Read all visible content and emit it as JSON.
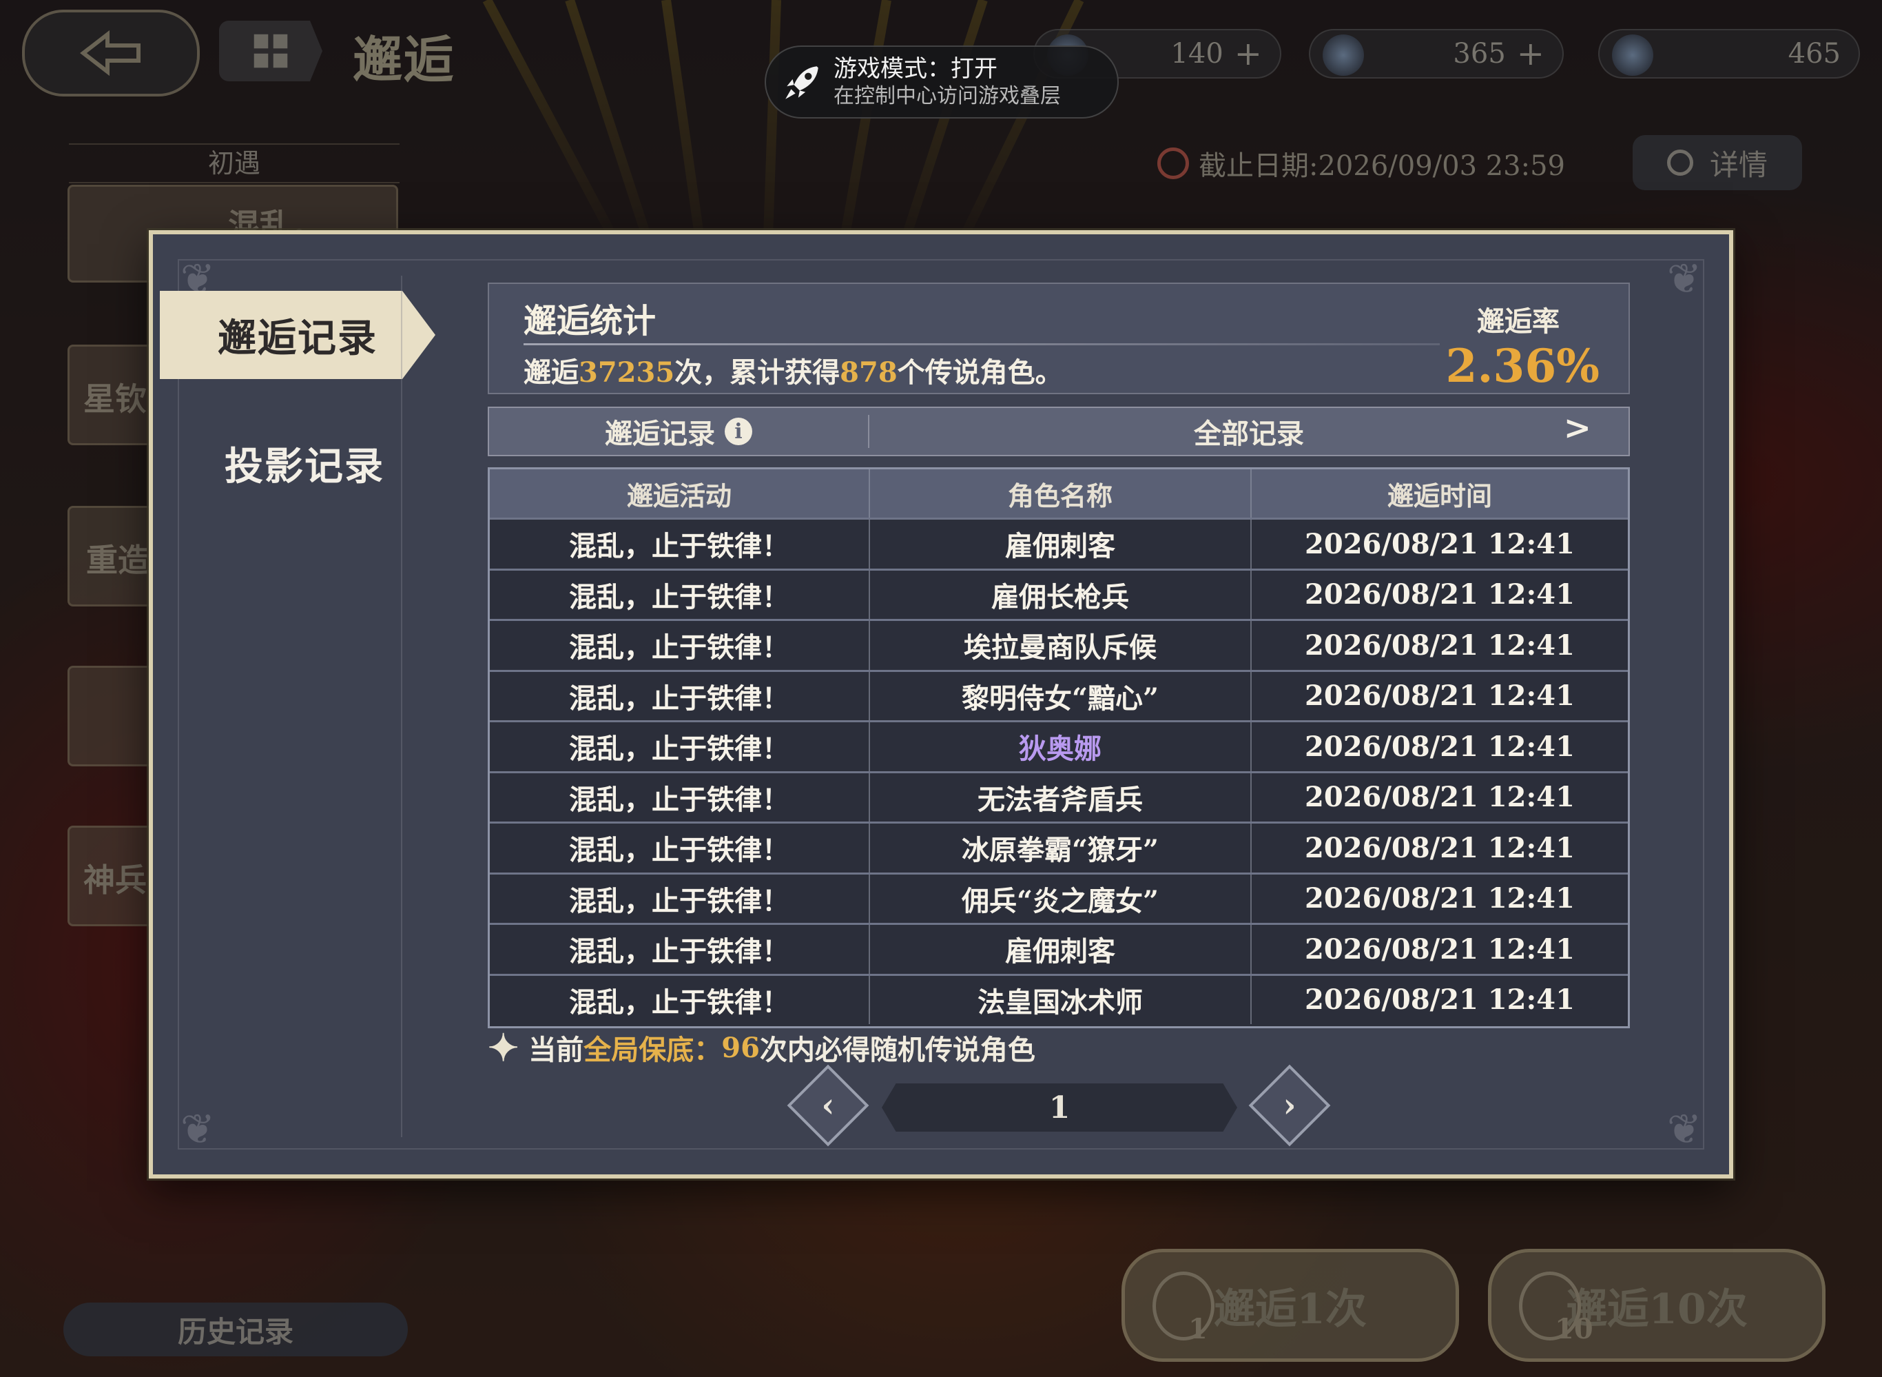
{
  "header": {
    "page_title": "邂逅",
    "resources": [
      {
        "name": "currency-1",
        "value": "140"
      },
      {
        "name": "currency-2",
        "value": "365"
      },
      {
        "name": "currency-3",
        "value": "465"
      }
    ],
    "deadline": "截止日期:2026/09/03 23:59",
    "detail_label": "详情"
  },
  "toast": {
    "title": "游戏模式：打开",
    "subtitle": "在控制中心访问游戏叠层"
  },
  "sidebar": {
    "first_label": "初遇",
    "card_labels": [
      "混乱，",
      "星钦",
      "重造",
      "神兵"
    ],
    "history_label": "历史记录"
  },
  "draw_buttons": {
    "single_label": "邂逅1次",
    "single_count": "1",
    "ten_label": "邂逅10次",
    "ten_count": "10"
  },
  "modal": {
    "tabs": [
      "邂逅记录",
      "投影记录"
    ],
    "stats": {
      "title": "邂逅统计",
      "text_prefix": "邂逅",
      "total_draws": "37235",
      "text_mid": "次，累计获得",
      "legendary_count": "878",
      "text_suffix": "个传说角色。",
      "rate_label": "邂逅率",
      "rate_value": "2.36%"
    },
    "filter": {
      "left_label": "邂逅记录",
      "right_label": "全部记录"
    },
    "table": {
      "headers": [
        "邂逅活动",
        "角色名称",
        "邂逅时间"
      ],
      "rows": [
        {
          "event": "混乱，止于铁律！",
          "name": "雇佣刺客",
          "time": "2026/08/21 12:41"
        },
        {
          "event": "混乱，止于铁律！",
          "name": "雇佣长枪兵",
          "time": "2026/08/21 12:41"
        },
        {
          "event": "混乱，止于铁律！",
          "name": "埃拉曼商队斥候",
          "time": "2026/08/21 12:41"
        },
        {
          "event": "混乱，止于铁律！",
          "name": "黎明侍女“黯心”",
          "time": "2026/08/21 12:41"
        },
        {
          "event": "混乱，止于铁律！",
          "name": "狄奥娜",
          "time": "2026/08/21 12:41"
        },
        {
          "event": "混乱，止于铁律！",
          "name": "无法者斧盾兵",
          "time": "2026/08/21 12:41"
        },
        {
          "event": "混乱，止于铁律！",
          "name": "冰原拳霸“獠牙”",
          "time": "2026/08/21 12:41"
        },
        {
          "event": "混乱，止于铁律！",
          "name": "佣兵“炎之魔女”",
          "time": "2026/08/21 12:41"
        },
        {
          "event": "混乱，止于铁律！",
          "name": "雇佣刺客",
          "time": "2026/08/21 12:41"
        },
        {
          "event": "混乱，止于铁律！",
          "name": "法皇国冰术师",
          "time": "2026/08/21 12:41"
        }
      ]
    },
    "pity": {
      "prefix": "当前",
      "highlight": "全局保底",
      "colon": "：",
      "count": "96",
      "suffix": "次内必得随机传说角色"
    },
    "pager": {
      "page": "1"
    },
    "colors": {
      "gold": "#e6b24b",
      "rate": "#e8a83c",
      "purple_name": "#b99af0"
    }
  }
}
